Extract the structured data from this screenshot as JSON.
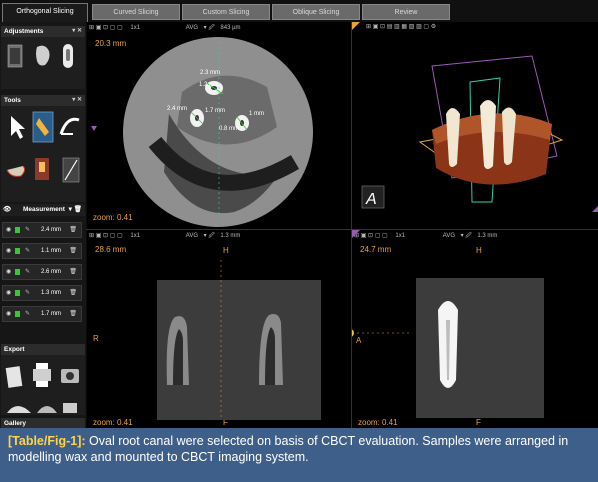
{
  "tabs": [
    {
      "label": "Orthogonal Slicing",
      "active": true
    },
    {
      "label": "Curved Slicing",
      "active": false
    },
    {
      "label": "Custom Slicing",
      "active": false
    },
    {
      "label": "Oblique Slicing",
      "active": false
    },
    {
      "label": "Review",
      "active": false
    }
  ],
  "sidebar": {
    "adjustments_label": "Adjustments",
    "tools_label": "Tools",
    "measurement_label": "Measurement",
    "measurements": [
      "2.4 mm",
      "1.1 mm",
      "2.6 mm",
      "1.3 mm",
      "1.7 mm"
    ],
    "export_label": "Export",
    "gallery_label": "Gallery"
  },
  "viewports": {
    "axial": {
      "depth": "20.3 mm",
      "toolbar_layout": "1x1",
      "avg_label": "AVG",
      "slab": "843 µm",
      "top_marker": "A",
      "bottom_marker": "P",
      "left_marker": "R",
      "zoom": "zoom: 0.41",
      "annotations": [
        "2.3 mm",
        "2.4 mm",
        "1.2 mm",
        "1.7 mm",
        "0.8 mm",
        "1 mm"
      ]
    },
    "render3d": {
      "orient_label": "A",
      "left_marker": "L"
    },
    "coronal": {
      "depth": "28.6 mm",
      "toolbar_layout": "1x1",
      "avg_label": "AVG",
      "slab": "1.3 mm",
      "top_marker": "H",
      "left_marker": "R",
      "zoom": "zoom: 0.41",
      "bottom_marker": "F"
    },
    "sagittal": {
      "depth": "24.7 mm",
      "toolbar_layout": "1x1",
      "avg_label": "AVG",
      "slab": "1.3 mm",
      "top_marker": "H",
      "left_marker": "A",
      "zoom": "zoom: 0.41",
      "bottom_marker": "F"
    }
  },
  "caption": {
    "label": "[Table/Fig-1]:",
    "text": " Oval root canal were selected on basis of CBCT evaluation. Samples were arranged in modelling wax and mounted to CBCT imaging system."
  },
  "colors": {
    "orange": "#e8a23a",
    "green": "#35c935",
    "caption_bg": "#3e5f8a",
    "caption_label": "#ffd34a",
    "teal": "#2fd0b0"
  }
}
